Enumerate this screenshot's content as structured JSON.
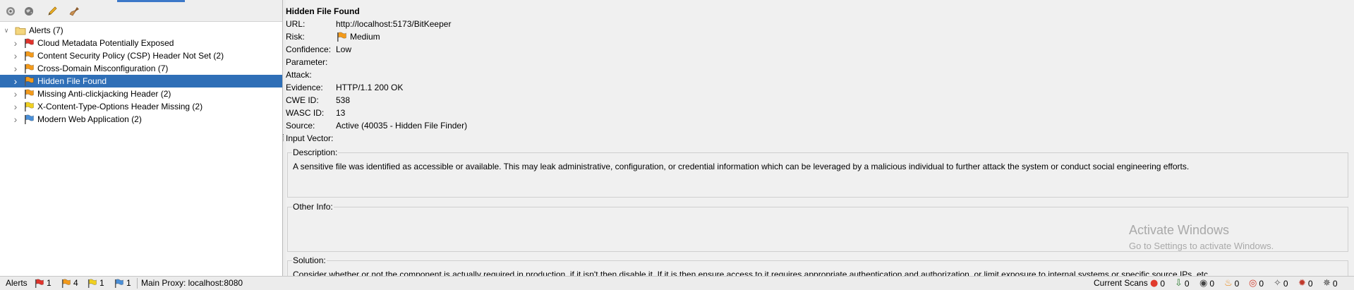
{
  "toolbar": {
    "icons": [
      "settings-gear-icon",
      "globe-icon",
      "edit-pencil-icon",
      "broom-icon"
    ]
  },
  "tree": {
    "root": {
      "label": "Alerts (7)",
      "icon": "folder-icon"
    },
    "items": [
      {
        "label": "Cloud Metadata Potentially Exposed",
        "risk": "high",
        "flag_color": "#e0332c"
      },
      {
        "label": "Content Security Policy (CSP) Header Not Set (2)",
        "risk": "medium",
        "flag_color": "#f39a1b"
      },
      {
        "label": "Cross-Domain Misconfiguration (7)",
        "risk": "medium",
        "flag_color": "#f39a1b"
      },
      {
        "label": "Hidden File Found",
        "risk": "medium",
        "flag_color": "#f39a1b",
        "selected": true
      },
      {
        "label": "Missing Anti-clickjacking Header (2)",
        "risk": "medium",
        "flag_color": "#f39a1b"
      },
      {
        "label": "X-Content-Type-Options Header Missing (2)",
        "risk": "low",
        "flag_color": "#f0d020"
      },
      {
        "label": "Modern Web Application (2)",
        "risk": "informational",
        "flag_color": "#4a8fd8"
      }
    ]
  },
  "detail": {
    "title": "Hidden File Found",
    "fields": [
      {
        "key": "URL:",
        "value": "http://localhost:5173/BitKeeper"
      },
      {
        "key": "Risk:",
        "value": "Medium",
        "flag_color": "#f39a1b"
      },
      {
        "key": "Confidence:",
        "value": "Low"
      },
      {
        "key": "Parameter:",
        "value": ""
      },
      {
        "key": "Attack:",
        "value": ""
      },
      {
        "key": "Evidence:",
        "value": "HTTP/1.1 200 OK"
      },
      {
        "key": "CWE ID:",
        "value": "538"
      },
      {
        "key": "WASC ID:",
        "value": "13"
      },
      {
        "key": "Source:",
        "value": "Active (40035 - Hidden File Finder)"
      },
      {
        "key": "Input Vector:",
        "value": ""
      }
    ],
    "description": {
      "label": "Description:",
      "text": "A sensitive file was identified as accessible or available. This may leak administrative, configuration, or credential information which can be leveraged by a malicious individual to further attack the system or conduct social engineering efforts."
    },
    "other_info": {
      "label": "Other Info:",
      "text": ""
    },
    "solution": {
      "label": "Solution:",
      "text": "Consider whether or not the component is actually required in production, if it isn't then disable it. If it is then ensure access to it requires appropriate authentication and authorization, or limit exposure to internal systems or specific source IPs, etc."
    }
  },
  "watermark": {
    "line1": "Activate Windows",
    "line2": "Go to Settings to activate Windows."
  },
  "status_bar": {
    "alerts_label": "Alerts",
    "alert_counts": [
      {
        "risk": "high",
        "count": "1",
        "color": "#e0332c"
      },
      {
        "risk": "medium",
        "count": "4",
        "color": "#f39a1b"
      },
      {
        "risk": "low",
        "count": "1",
        "color": "#f0d020"
      },
      {
        "risk": "informational",
        "count": "1",
        "color": "#4a8fd8"
      }
    ],
    "proxy": "Main Proxy: localhost:8080",
    "current_scans_label": "Current Scans",
    "scan_counts": [
      {
        "icon": "active-scan-icon",
        "count": "0"
      },
      {
        "icon": "spider-download-icon",
        "count": "0"
      },
      {
        "icon": "eye-icon",
        "count": "0"
      },
      {
        "icon": "fuzzer-flame-icon",
        "count": "0"
      },
      {
        "icon": "target-icon",
        "count": "0"
      },
      {
        "icon": "ajax-spider-icon",
        "count": "0"
      },
      {
        "icon": "bug-icon",
        "count": "0"
      },
      {
        "icon": "web-spider-icon",
        "count": "0"
      }
    ]
  }
}
